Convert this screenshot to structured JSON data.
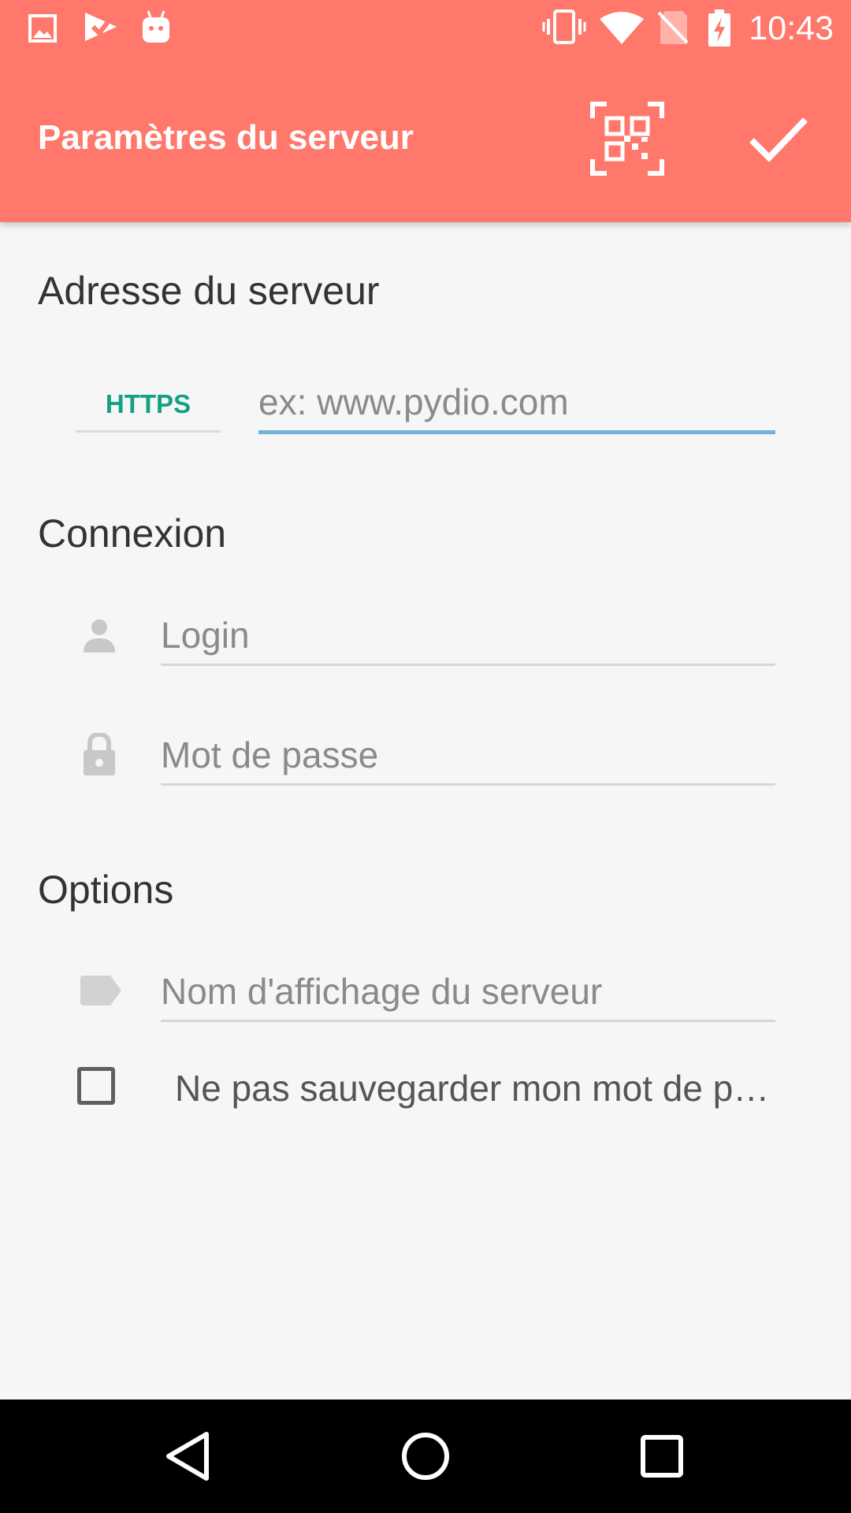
{
  "status_bar": {
    "time": "10:43",
    "left_icons": [
      "gallery-icon",
      "play-store-check-icon",
      "android-icon"
    ],
    "right_icons": [
      "vibrate-icon",
      "wifi-icon",
      "no-sim-icon",
      "battery-charging-icon"
    ]
  },
  "toolbar": {
    "title": "Paramètres du serveur",
    "actions": [
      "qr-code-icon",
      "check-icon"
    ],
    "color": "#ff786b"
  },
  "server_section": {
    "title": "Adresse du serveur",
    "protocol": "HTTPS",
    "address_placeholder": "ex: www.pydio.com",
    "address_value": ""
  },
  "connection_section": {
    "title": "Connexion",
    "login_placeholder": "Login",
    "password_placeholder": "Mot de passe"
  },
  "options_section": {
    "title": "Options",
    "display_name_placeholder": "Nom d'affichage du serveur",
    "dont_save_password_label": "Ne pas sauvegarder mon mot de passe",
    "dont_save_password_checked": false
  },
  "nav_bar": {
    "buttons": [
      "back-icon",
      "home-icon",
      "recents-icon"
    ]
  },
  "colors": {
    "accent": "#13a085",
    "field_focus": "#6fb3da"
  }
}
